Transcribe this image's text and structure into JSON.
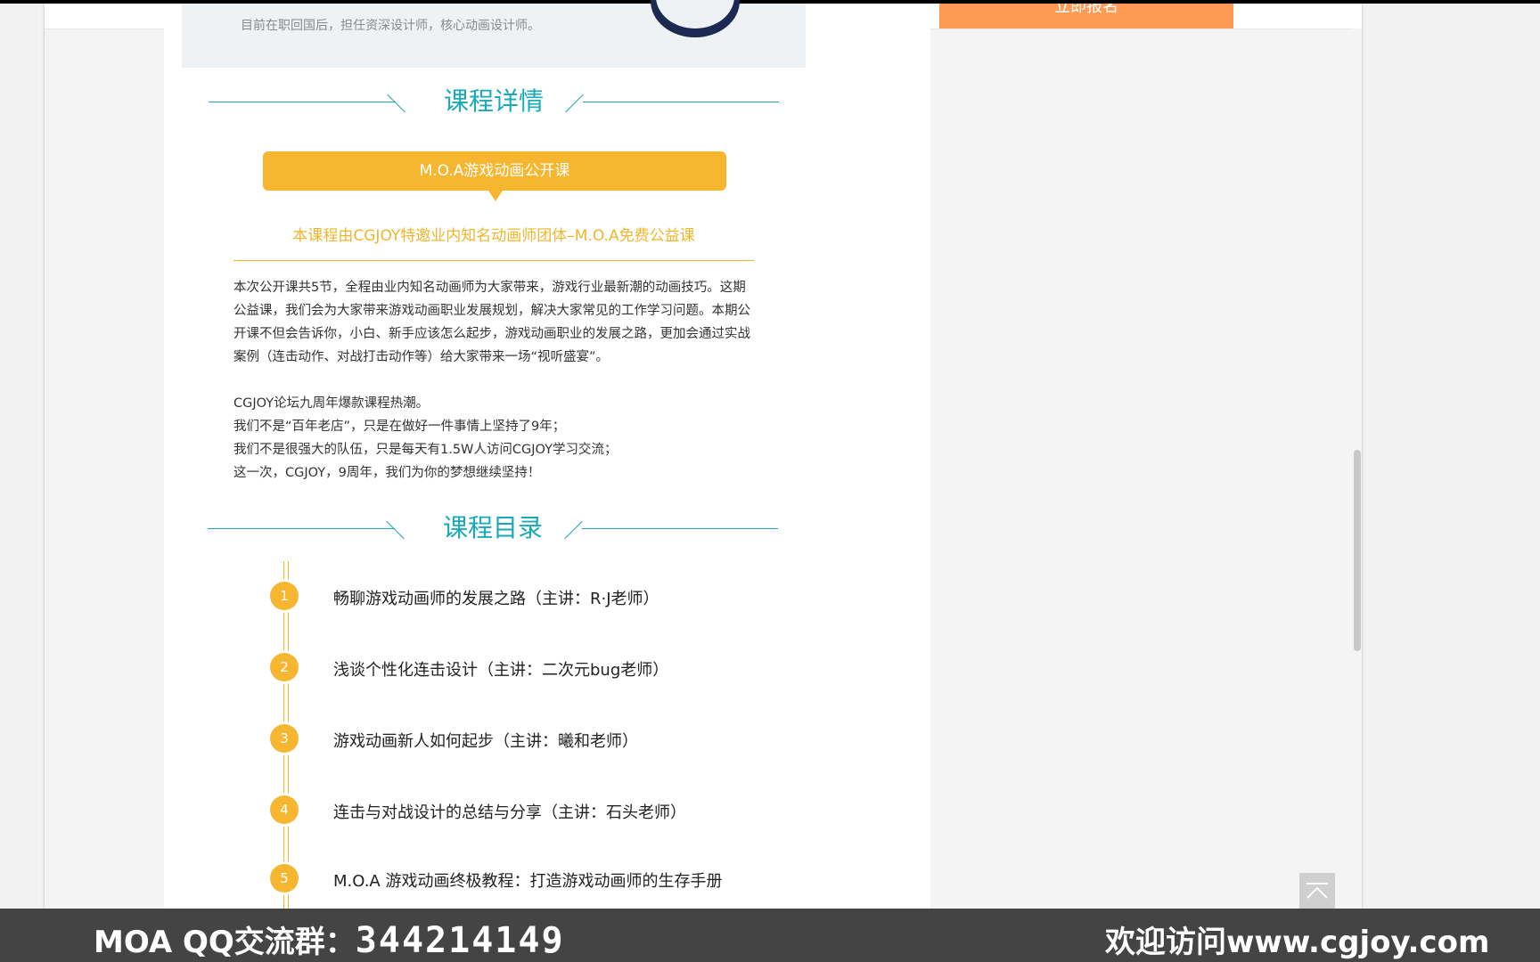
{
  "teacher": {
    "truncated_text": "目前在职回国后，担任资深设计师，核心动画设计师。"
  },
  "signup_button": "立即报名",
  "detail_section": {
    "title": "课程详情",
    "pill_title": "M.O.A游戏动画公开课",
    "subtitle": "本课程由CGJOY特邀业内知名动画师团体–M.O.A免费公益课",
    "paragraph1": "本次公开课共5节，全程由业内知名动画师为大家带来，游戏行业最新潮的动画技巧。这期公益课，我们会为大家带来游戏动画职业发展规划，解决大家常见的工作学习问题。本期公开课不但会告诉你，小白、新手应该怎么起步，游戏动画职业的发展之路，更加会通过实战案例（连击动作、对战打击动作等）给大家带来一场“视听盛宴”。",
    "lines": [
      "CGJOY论坛九周年爆款课程热潮。",
      "我们不是“百年老店”，只是在做好一件事情上坚持了9年；",
      "我们不是很强大的队伍，只是每天有1.5W人访问CGJOY学习交流；",
      "这一次，CGJOY，9周年，我们为你的梦想继续坚持！"
    ]
  },
  "catalog_section": {
    "title": "课程目录",
    "items": [
      {
        "num": "1",
        "text": "畅聊游戏动画师的发展之路（主讲：R·J老师）"
      },
      {
        "num": "2",
        "text": "浅谈个性化连击设计（主讲：二次元bug老师）"
      },
      {
        "num": "3",
        "text": "游戏动画新人如何起步（主讲：曦和老师）"
      },
      {
        "num": "4",
        "text": "连击与对战设计的总结与分享（主讲：石头老师）"
      },
      {
        "num": "5",
        "text": "M.O.A 游戏动画终极教程：打造游戏动画师的生存手册"
      }
    ]
  },
  "footer": {
    "left_prefix": "MOA QQ",
    "left_label": "交流群：",
    "qq_number": "344214149",
    "right_label": "欢迎访问",
    "site": "www.cgjoy.com"
  },
  "icons": {
    "back_to_top": "arrow-up-icon"
  }
}
